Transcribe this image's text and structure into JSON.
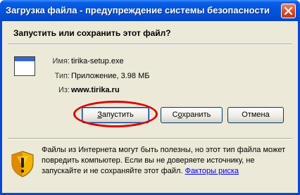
{
  "window": {
    "title": "Загрузка файла - предупреждение системы безопасности"
  },
  "prompt": "Запустить или сохранить этот файл?",
  "file": {
    "name_label": "Имя:",
    "name": "tirika-setup.exe",
    "type_label": "Тип:",
    "type": "Приложение, 3.98 МБ",
    "from_label": "Из:",
    "from": "www.tirika.ru"
  },
  "buttons": {
    "run": {
      "underlined": "З",
      "rest": "апустить"
    },
    "save": {
      "prefix": "С",
      "underlined": "о",
      "rest": "хранить"
    },
    "cancel": "Отмена"
  },
  "warning": {
    "text": "Файлы из Интернета могут быть полезны, но этот тип файла может повредить компьютер. Если вы не доверяете источнику, не запускайте и не сохраняйте этот файл.",
    "link": "Факторы риска"
  },
  "colors": {
    "titlebar": "#0454e0",
    "dialog_bg": "#ece9d8",
    "highlight_ellipse": "#e00000",
    "link": "#0000ff"
  },
  "icons": [
    "close-icon",
    "application-file-icon",
    "security-shield-icon"
  ]
}
